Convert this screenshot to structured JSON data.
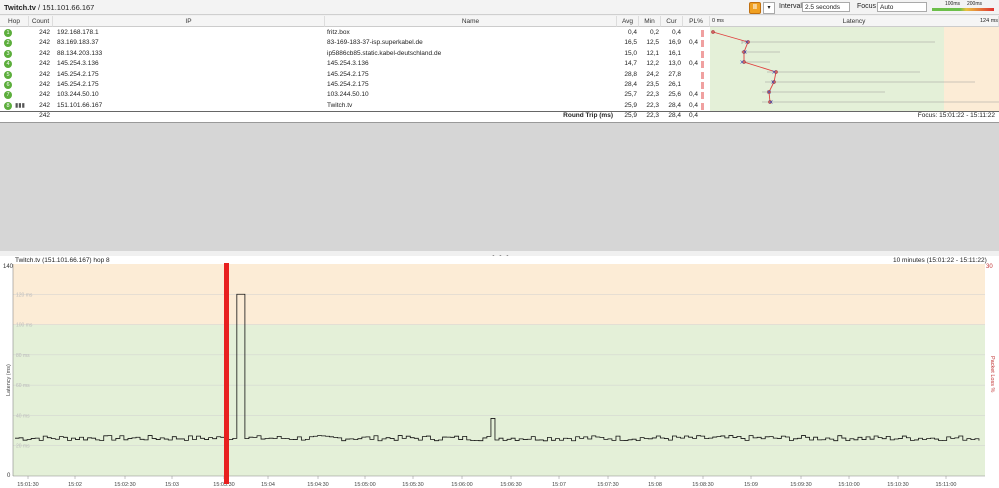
{
  "header": {
    "title_bold": "Twitch.tv",
    "title_rest": " / 151.101.66.167"
  },
  "toolbar": {
    "pause_label": "II",
    "dropdown_glyph": "▾",
    "interval_label": "Interval",
    "interval_value": "2.5 seconds",
    "focus_label": "Focus",
    "focus_value": "Auto",
    "legend_100": "100ms",
    "legend_200": "200ms"
  },
  "table": {
    "columns": [
      "Hop",
      "Count",
      "IP",
      "Name",
      "Avg",
      "Min",
      "Cur",
      "PL%",
      "Latency"
    ],
    "latency_scale_min": "0 ms",
    "latency_scale_max": "124 ms",
    "rows": [
      {
        "hop": "1",
        "count": "242",
        "ip": "192.168.178.1",
        "name": "fritz.box",
        "avg": "0,4",
        "min": "0,2",
        "cur": "0,4",
        "pl": ""
      },
      {
        "hop": "2",
        "count": "242",
        "ip": "83.169.183.37",
        "name": "83-169-183-37-isp.superkabel.de",
        "avg": "16,5",
        "min": "12,5",
        "cur": "16,9",
        "pl": "0,4"
      },
      {
        "hop": "3",
        "count": "242",
        "ip": "88.134.203.133",
        "name": "ip5886cb85.static.kabel-deutschland.de",
        "avg": "15,0",
        "min": "12,1",
        "cur": "16,1",
        "pl": ""
      },
      {
        "hop": "4",
        "count": "242",
        "ip": "145.254.3.136",
        "name": "145.254.3.136",
        "avg": "14,7",
        "min": "12,2",
        "cur": "13,0",
        "pl": "0,4"
      },
      {
        "hop": "5",
        "count": "242",
        "ip": "145.254.2.175",
        "name": "145.254.2.175",
        "avg": "28,8",
        "min": "24,2",
        "cur": "27,8",
        "pl": ""
      },
      {
        "hop": "6",
        "count": "242",
        "ip": "145.254.2.175",
        "name": "145.254.2.175",
        "avg": "28,4",
        "min": "23,5",
        "cur": "26,1",
        "pl": ""
      },
      {
        "hop": "7",
        "count": "242",
        "ip": "103.244.50.10",
        "name": "103.244.50.10",
        "avg": "25,7",
        "min": "22,3",
        "cur": "25,6",
        "pl": "0,4"
      },
      {
        "hop": "8",
        "count": "242",
        "ip": "151.101.66.167",
        "name": "Twitch.tv",
        "avg": "25,9",
        "min": "22,3",
        "cur": "28,4",
        "pl": "0,4"
      }
    ],
    "summary": {
      "count": "242",
      "label": "Round Trip (ms)",
      "avg": "25,9",
      "min": "22,3",
      "cur": "28,4",
      "pl": "0,4",
      "focus": "Focus: 15:01:22 - 15:11:22"
    }
  },
  "grip": "• • •",
  "chart": {
    "title": "Twitch.tv (151.101.66.167) hop 8",
    "range": "10 minutes (15:01:22 - 15:11:22)",
    "y_left_max": "140",
    "y_left_min": "0",
    "y_right_max": "30",
    "ylabel": "Latency (ms)",
    "y2label": "Packet Loss %",
    "gridlabels": [
      "120 ms",
      "100 ms",
      "80 ms",
      "60 ms",
      "40 ms",
      "20 ms"
    ],
    "xticks": [
      "15:01:30",
      "15:02",
      "15:02:30",
      "15:03",
      "15:03:30",
      "15:04",
      "15:04:30",
      "15:05:00",
      "15:05:30",
      "15:06:00",
      "15:06:30",
      "15:07",
      "15:07:30",
      "15:08",
      "15:08:30",
      "15:09",
      "15:09:30",
      "15:10:00",
      "15:10:30",
      "15:11:00"
    ]
  },
  "chart_data": {
    "type": "line",
    "ylim": [
      0,
      140
    ],
    "y2lim": [
      0,
      30
    ],
    "baseline_ms": 25,
    "spikes": [
      {
        "time": "15:02:38",
        "ms": 120
      },
      {
        "time": "15:05:20",
        "ms": 38
      }
    ],
    "packet_loss_marker_time": "15:03:27",
    "zones": [
      {
        "from": 0,
        "to": 100,
        "color": "#e4f0d8"
      },
      {
        "from": 100,
        "to": 140,
        "color": "#fcecd6"
      }
    ]
  }
}
